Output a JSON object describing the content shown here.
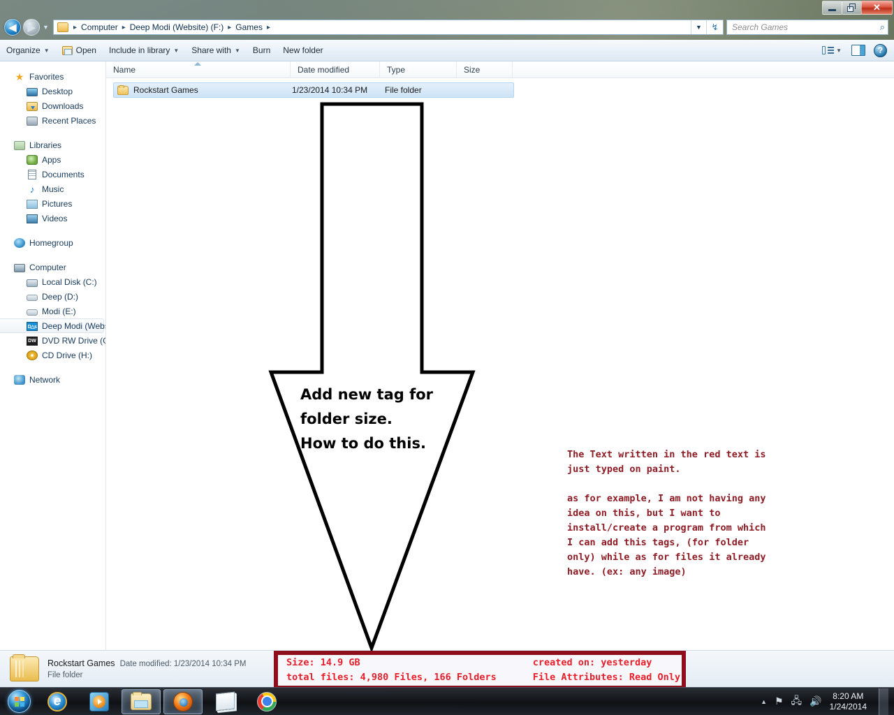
{
  "window": {
    "minimize_label": "Minimize",
    "restore_label": "Restore",
    "close_label": "✕"
  },
  "address": {
    "back_glyph": "◀",
    "forward_glyph": "▶",
    "history_glyph": "▼",
    "crumbs": [
      "Computer",
      "Deep Modi (Website) (F:)",
      "Games"
    ],
    "separator": "▸",
    "dropdown_glyph": "▼",
    "refresh_glyph": "↯"
  },
  "search": {
    "placeholder": "Search Games",
    "icon": "search-icon",
    "glyph": "⌕"
  },
  "toolbar": {
    "organize": "Organize",
    "open": "Open",
    "include_in_library": "Include in library",
    "share_with": "Share with",
    "burn": "Burn",
    "new_folder": "New folder",
    "caret": "▼",
    "view_icon": "view-list-icon",
    "preview_pane_icon": "preview-pane-icon",
    "help_icon": "help-icon",
    "help_glyph": "?"
  },
  "sidebar": {
    "groups": [
      {
        "name": "Favorites",
        "icon": "star-icon",
        "items": [
          {
            "label": "Desktop",
            "icon": "desktop-icon"
          },
          {
            "label": "Downloads",
            "icon": "downloads-icon"
          },
          {
            "label": "Recent Places",
            "icon": "recent-places-icon"
          }
        ]
      },
      {
        "name": "Libraries",
        "icon": "libraries-icon",
        "items": [
          {
            "label": "Apps",
            "icon": "apps-icon"
          },
          {
            "label": "Documents",
            "icon": "documents-icon"
          },
          {
            "label": "Music",
            "icon": "music-icon"
          },
          {
            "label": "Pictures",
            "icon": "pictures-icon"
          },
          {
            "label": "Videos",
            "icon": "videos-icon"
          }
        ]
      },
      {
        "name": "Homegroup",
        "icon": "homegroup-icon",
        "items": []
      },
      {
        "name": "Computer",
        "icon": "computer-icon",
        "items": [
          {
            "label": "Local Disk (C:)",
            "icon": "hard-disk-icon"
          },
          {
            "label": "Deep (D:)",
            "icon": "drive-icon"
          },
          {
            "label": "Modi (E:)",
            "icon": "drive-icon"
          },
          {
            "label": "Deep Modi (Websit",
            "icon": "usb-drive-icon",
            "selected": true
          },
          {
            "label": "DVD RW Drive (G:) (",
            "icon": "dvd-drive-icon"
          },
          {
            "label": "CD Drive (H:)",
            "icon": "cd-drive-icon"
          }
        ]
      },
      {
        "name": "Network",
        "icon": "network-icon",
        "items": []
      }
    ]
  },
  "filelist": {
    "columns": [
      "Name",
      "Date modified",
      "Type",
      "Size"
    ],
    "rows": [
      {
        "name": "Rockstart Games",
        "date_modified": "1/23/2014 10:34 PM",
        "type": "File folder",
        "size": ""
      }
    ]
  },
  "statusbar": {
    "item_name": "Rockstart Games",
    "date_label": "Date modified: 1/23/2014 10:34 PM",
    "item_type": "File folder"
  },
  "annotations": {
    "arrow_text": "Add new tag for\nfolder size.\nHow to do this.",
    "paint_note": "The Text written in the red text is\njust typed on paint.\n\nas for example, I am not having any\nidea on this, but I want to\ninstall/create a program from which\nI can add this tags, (for folder\nonly) while as for files it already\nhave. (ex: any image)",
    "red_box": {
      "left_lines": "Size: 14.9 GB\n total files:  4,980 Files, 166 Folders",
      "right_lines": "created on: yesterday\nFile Attributes: Read Only",
      "border_color": "#8e0f1b",
      "text_color": "#e5202a"
    },
    "arrow_color": "#000000",
    "note_color": "#8e1c25"
  },
  "taskbar": {
    "start_label": "Start",
    "buttons": [
      {
        "name": "internet-explorer",
        "glyph": "e"
      },
      {
        "name": "windows-media-player",
        "glyph": ""
      },
      {
        "name": "windows-explorer",
        "glyph": "",
        "active": true
      },
      {
        "name": "firefox",
        "glyph": "",
        "active": true
      },
      {
        "name": "notepad",
        "glyph": ""
      },
      {
        "name": "google-chrome",
        "glyph": ""
      }
    ],
    "tray": {
      "expand_glyph": "▲",
      "network_glyph": "⚑",
      "action_glyph": "🖧",
      "volume_glyph": "🔊",
      "time": "8:20 AM",
      "date": "1/24/2014"
    }
  }
}
